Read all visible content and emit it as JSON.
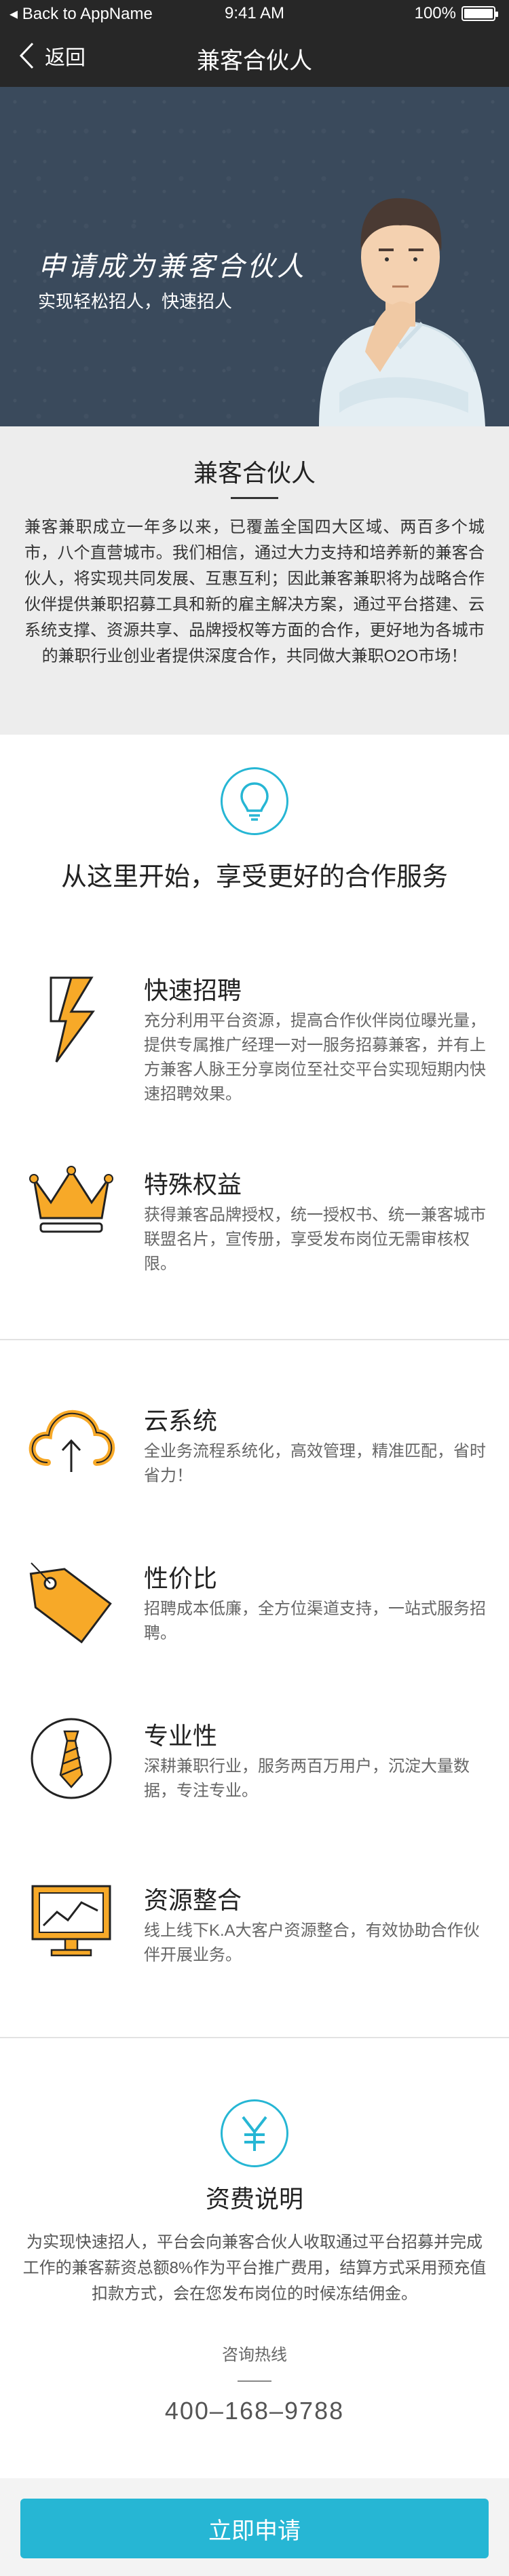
{
  "status_bar": {
    "back_app": "Back to AppName",
    "time": "9:41 AM",
    "battery": "100%",
    "battery_level": 1.0
  },
  "nav": {
    "back_label": "返回",
    "title": "兼客合伙人"
  },
  "hero": {
    "title": "申请成为兼客合伙人",
    "subtitle": "实现轻松招人，快速招人"
  },
  "intro": {
    "heading": "兼客合伙人",
    "paragraph": "兼客兼职成立一年多以来，已覆盖全国四大区域、两百多个城市，八个直营城市。我们相信，通过大力支持和培养新的兼客合伙人，将实现共同发展、互惠互利；因此兼客兼职将为战略合作伙伴提供兼职招募工具和新的雇主解决方案，通过平台搭建、云系统支撑、资源共享、品牌授权等方面的合作，更好地为各城市的兼职行业创业者提供深度合作，共同做大兼职O2O市场！"
  },
  "cooperation": {
    "icon": "lightbulb-icon",
    "title": "从这里开始，享受更好的合作服务"
  },
  "features": [
    {
      "icon": "lightning-icon",
      "name": "快速招聘",
      "desc": "充分利用平台资源，提高合作伙伴岗位曝光量，提供专属推广经理一对一服务招募兼客，并有上方兼客人脉王分享岗位至社交平台实现短期内快速招聘效果。"
    },
    {
      "icon": "crown-icon",
      "name": "特殊权益",
      "desc": "获得兼客品牌授权，统一授权书、统一兼客城市联盟名片，宣传册，享受发布岗位无需审核权限。"
    },
    {
      "icon": "cloud-upload-icon",
      "name": "云系统",
      "desc": "全业务流程系统化，高效管理，精准匹配，省时省力！"
    },
    {
      "icon": "price-tag-icon",
      "name": "性价比",
      "desc": "招聘成本低廉，全方位渠道支持，一站式服务招聘。"
    },
    {
      "icon": "necktie-icon",
      "name": "专业性",
      "desc": "深耕兼职行业，服务两百万用户，沉淀大量数据，专注专业。"
    },
    {
      "icon": "monitor-chart-icon",
      "name": "资源整合",
      "desc": "线上线下K.A大客户资源整合，有效协助合作伙伴开展业务。"
    }
  ],
  "fees": {
    "icon": "yen-icon",
    "title": "资费说明",
    "paragraph": "为实现快速招人，平台会向兼客合伙人收取通过平台招募并完成工作的兼客薪资总额8%作为平台推广费用，结算方式采用预充值扣款方式，会在您发布岗位的时候冻结佣金。",
    "hotline_label": "咨询热线",
    "hotline_number": "400–168–9788"
  },
  "apply_button": "立即申请",
  "colors": {
    "accent": "#26b6d4",
    "icon_orange": "#f7a928",
    "dark_bar": "#272727",
    "hero_bg": "#3a4a5c",
    "intro_bg": "#ededed"
  }
}
